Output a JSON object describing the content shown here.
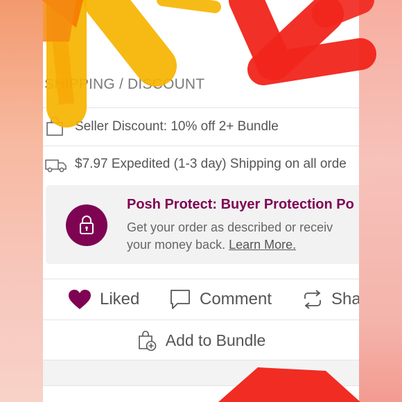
{
  "section": {
    "heading": "SHIPPING / DISCOUNT"
  },
  "rows": {
    "discount": "Seller Discount: 10% off 2+ Bundle",
    "shipping": "$7.97 Expedited (1-3 day) Shipping on all orde"
  },
  "protect": {
    "title": "Posh Protect: Buyer Protection Po",
    "line1": "Get your order as described or receiv",
    "line2_prefix": "your money back.",
    "learn_more": "Learn More."
  },
  "actions": {
    "liked": "Liked",
    "comment": "Comment",
    "share": "Sha",
    "bundle": "Add to Bundle"
  },
  "colors": {
    "brand": "#7f0353",
    "liked_heart": "#7f0353",
    "marker_yellow": "#f7b400",
    "marker_orange": "#f57a00",
    "marker_red": "#f1251c"
  },
  "icons": {
    "discount": "shopping-bag-icon",
    "shipping": "truck-icon",
    "protect": "lock-icon",
    "liked": "heart-icon",
    "comment": "comment-bubble-icon",
    "share": "share-arrows-icon",
    "bundle": "bag-plus-icon"
  }
}
